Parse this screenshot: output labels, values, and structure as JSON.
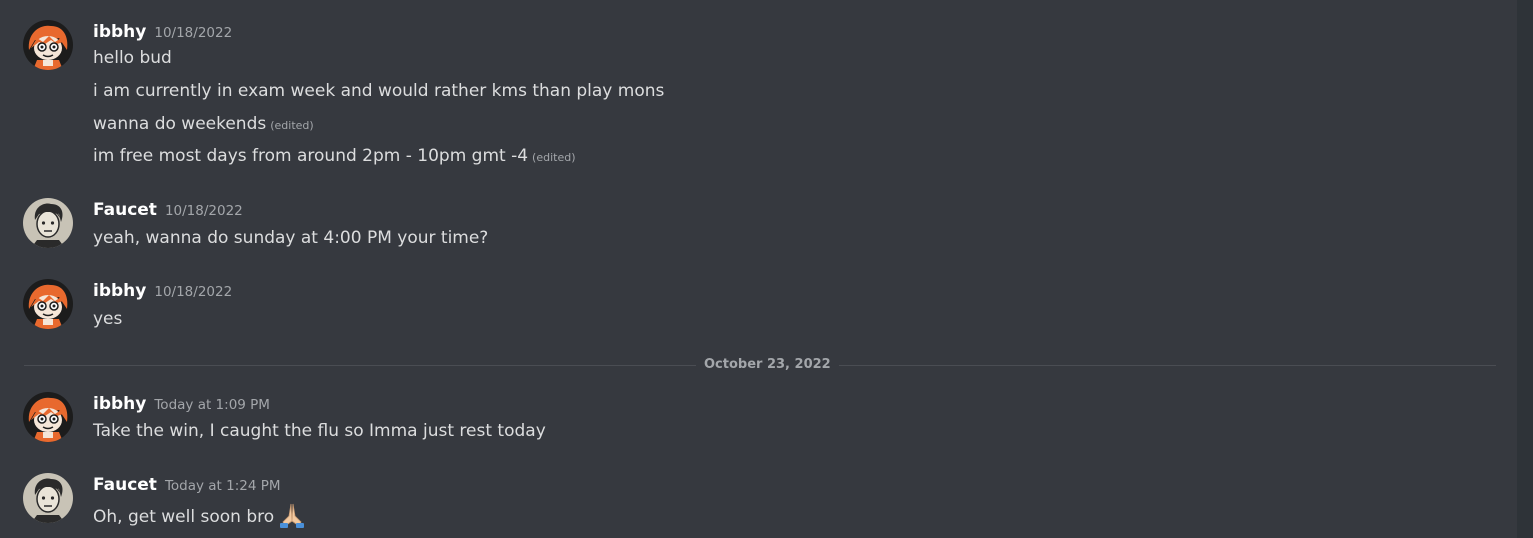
{
  "messages": [
    {
      "author": "ibbhy",
      "timestamp": "10/18/2022",
      "lines": [
        {
          "text": "hello bud",
          "edited": ""
        },
        {
          "text": "i am currently in exam week and would rather kms than play mons",
          "edited": ""
        },
        {
          "text": "wanna do weekends",
          "edited": "(edited)"
        },
        {
          "text": "im free most days from around 2pm - 10pm gmt -4",
          "edited": "(edited)"
        }
      ]
    },
    {
      "author": "Faucet",
      "timestamp": "10/18/2022",
      "lines": [
        {
          "text": "yeah, wanna do sunday at 4:00 PM your time?"
        }
      ]
    },
    {
      "author": "ibbhy",
      "timestamp": "10/18/2022",
      "lines": [
        {
          "text": "yes"
        }
      ]
    },
    {
      "author": "ibbhy",
      "timestamp": "Today at 1:09 PM",
      "lines": [
        {
          "text": "Take the win, I caught the flu so Imma just rest today"
        }
      ]
    },
    {
      "author": "Faucet",
      "timestamp": "Today at 1:24 PM",
      "lines": [
        {
          "text": "Oh, get well soon bro",
          "emoji": "folded-hands"
        }
      ]
    }
  ],
  "date_divider": "October 23, 2022",
  "colors": {
    "background": "#36393f",
    "username": "#ffffff",
    "message_text": "#dcddde",
    "muted": "#a3a6aa",
    "ibbhy_avatar_hair": "#e8692e",
    "faucet_avatar_bg": "#c8c3b6"
  }
}
